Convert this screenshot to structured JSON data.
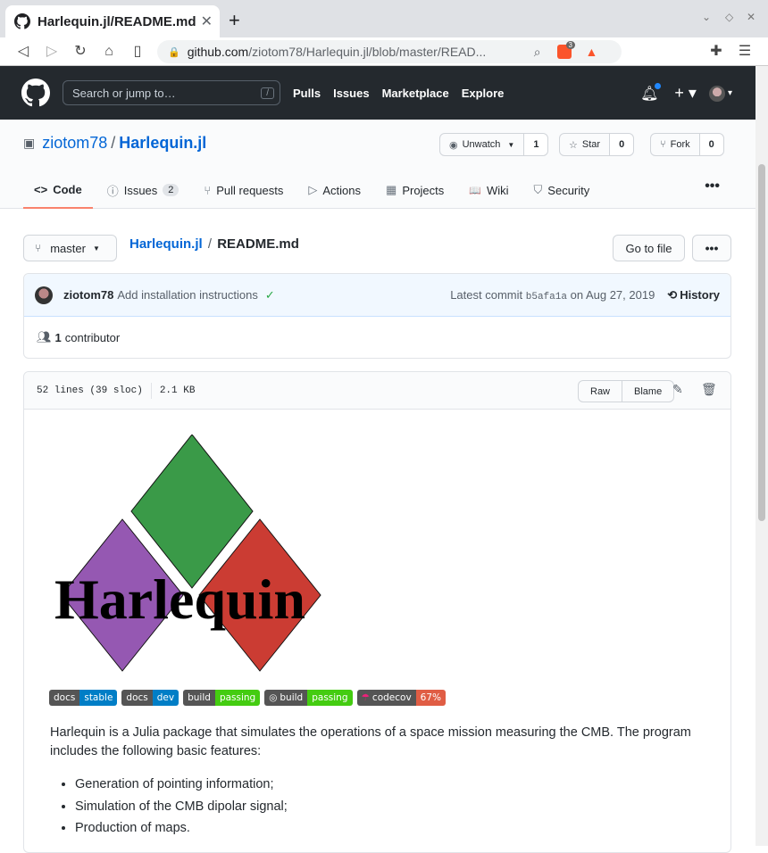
{
  "browser": {
    "tab_title": "Harlequin.jl/README.md",
    "url_host": "github.com",
    "url_path": "/ziotom78/Harlequin.jl/blob/master/READ...",
    "brave_count": "3"
  },
  "github": {
    "search_placeholder": "Search or jump to…",
    "search_key": "/",
    "nav": [
      "Pulls",
      "Issues",
      "Marketplace",
      "Explore"
    ]
  },
  "repo": {
    "owner": "ziotom78",
    "separator": "/",
    "name": "Harlequin.jl",
    "watch_label": "Unwatch",
    "watch_count": "1",
    "star_label": "Star",
    "star_count": "0",
    "fork_label": "Fork",
    "fork_count": "0",
    "tabs": [
      {
        "label": "Code",
        "icon": "<>"
      },
      {
        "label": "Issues",
        "icon": "ⓘ",
        "count": "2"
      },
      {
        "label": "Pull requests",
        "icon": "⑂"
      },
      {
        "label": "Actions",
        "icon": "▷"
      },
      {
        "label": "Projects",
        "icon": "▦"
      },
      {
        "label": "Wiki",
        "icon": "📖"
      },
      {
        "label": "Security",
        "icon": "⛉"
      }
    ],
    "more": "•••"
  },
  "file_nav": {
    "branch": "master",
    "crumb_repo": "Harlequin.jl",
    "crumb_sep": "/",
    "crumb_file": "README.md",
    "go_to_file": "Go to file",
    "more": "•••"
  },
  "commit": {
    "author": "ziotom78",
    "message": "Add installation instructions",
    "latest_prefix": "Latest commit",
    "sha": "b5afa1a",
    "date": "on Aug 27, 2019",
    "history": "History",
    "contributor_count": "1",
    "contributor_label": "contributor"
  },
  "file": {
    "lines": "52 lines (39 sloc)",
    "size": "2.1 KB",
    "raw": "Raw",
    "blame": "Blame"
  },
  "readme": {
    "logo_text": "Harlequin",
    "badges": [
      {
        "left": "docs",
        "right": "stable",
        "color": "#007ec6"
      },
      {
        "left": "docs",
        "right": "dev",
        "color": "#007ec6"
      },
      {
        "left": "build",
        "right": "passing",
        "color": "#4c1"
      },
      {
        "left": "build",
        "right": "passing",
        "color": "#4c1"
      },
      {
        "left": "codecov",
        "right": "67%",
        "color": "#e05d44"
      }
    ],
    "paragraph": "Harlequin is a Julia package that simulates the operations of a space mission measuring the CMB. The program includes the following basic features:",
    "features": [
      "Generation of pointing information;",
      "Simulation of the CMB dipolar signal;",
      "Production of maps."
    ]
  },
  "colors": {
    "diamond_green": "#3a9a48",
    "diamond_purple": "#9558b2",
    "diamond_red": "#cb3c33"
  }
}
